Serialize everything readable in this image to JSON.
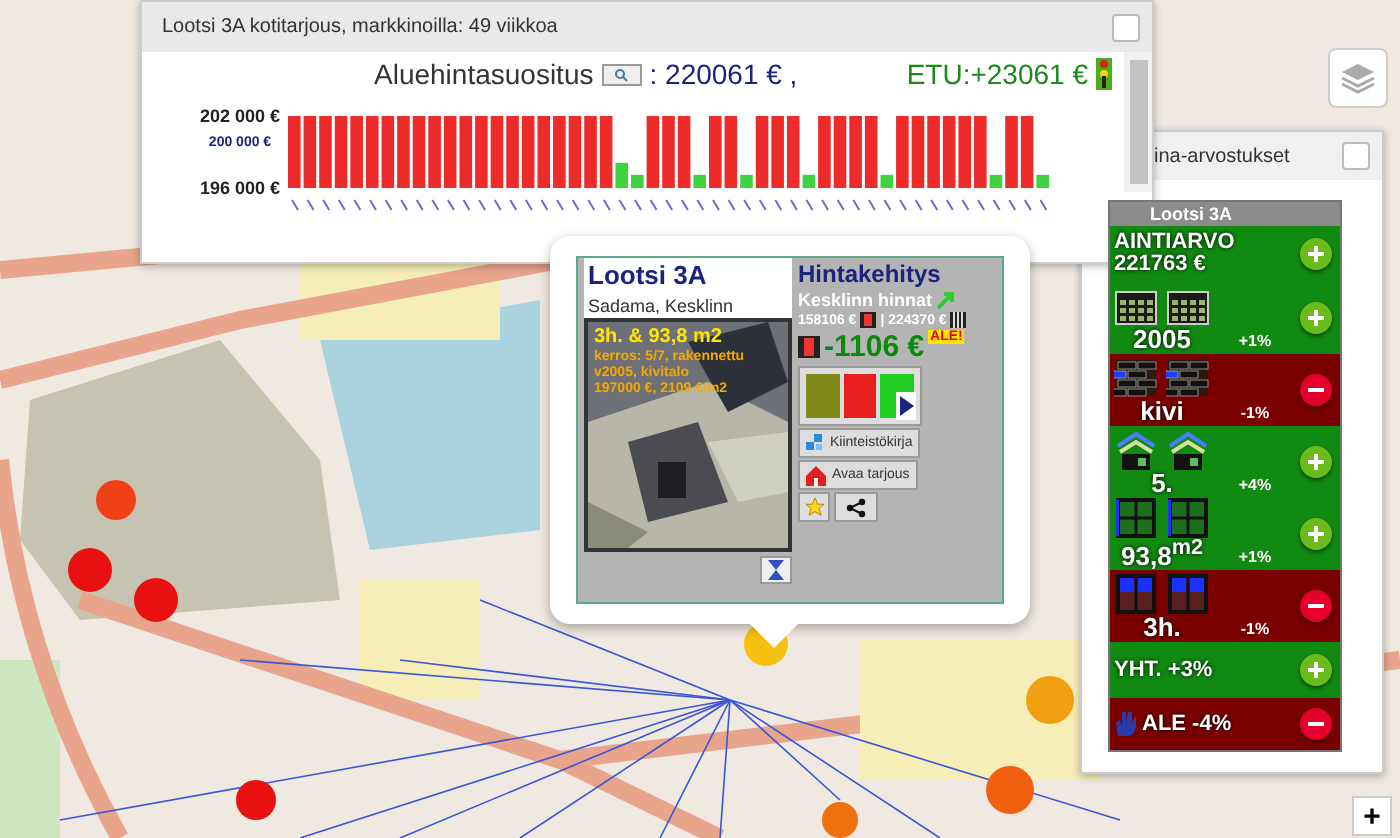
{
  "chart_window": {
    "title": "Lootsi 3A kotitarjous, markkinoilla: 49 viikkoa",
    "checked": false,
    "recommendation_label": "Aluehintasuositus",
    "recommendation_value": ": 220061 € ,",
    "advantage": "ETU:+23061 €",
    "chart_data": {
      "type": "bar",
      "categories": [
        null,
        null,
        null,
        null,
        null,
        null,
        null,
        null,
        null,
        null,
        null,
        null,
        null,
        null,
        null,
        null,
        null,
        null,
        null,
        null,
        null,
        null,
        null,
        null,
        null,
        null,
        null,
        null,
        null,
        null,
        null,
        null,
        null,
        null,
        null,
        null,
        null,
        null,
        null,
        null,
        null,
        null,
        null,
        null,
        null,
        null,
        null,
        null,
        null
      ],
      "ylim": [
        196000,
        202000
      ],
      "yticks": [
        {
          "value": 196000,
          "label": "196 000 €"
        },
        {
          "value": 200000,
          "label": "200 000 €"
        },
        {
          "value": 202000,
          "label": "202 000 €"
        }
      ],
      "stacked": true,
      "series": [
        {
          "color": "#ee2b2b",
          "values": [
            202000,
            202000,
            202000,
            202000,
            202000,
            202000,
            202000,
            202000,
            202000,
            202000,
            202000,
            202000,
            202000,
            202000,
            202000,
            202000,
            202000,
            202000,
            202000,
            202000,
            202000,
            null,
            null,
            202000,
            202000,
            202000,
            null,
            202000,
            202000,
            null,
            202000,
            202000,
            202000,
            null,
            202000,
            202000,
            202000,
            202000,
            null,
            202000,
            202000,
            202000,
            202000,
            202000,
            202000,
            null,
            202000,
            202000,
            null
          ]
        },
        {
          "color": "#3fd43f",
          "values": [
            null,
            null,
            null,
            null,
            null,
            null,
            null,
            null,
            null,
            null,
            null,
            null,
            null,
            null,
            null,
            null,
            null,
            null,
            null,
            null,
            null,
            198100,
            197100,
            null,
            null,
            null,
            197100,
            null,
            null,
            197100,
            null,
            null,
            null,
            197100,
            null,
            null,
            null,
            null,
            197100,
            null,
            null,
            null,
            null,
            null,
            null,
            197100,
            null,
            null,
            197100
          ]
        }
      ]
    }
  },
  "info_popup": {
    "title": "Lootsi 3A",
    "location": "Sadama, Kesklinn",
    "photo_lines": [
      "3h. & 93,8 m2",
      "kerros: 5/7, rakennettu v2005, kivitalo",
      "197000 €, 2109 €/m2"
    ],
    "price_title": "Hintakehitys",
    "area_prices": "Kesklinn hinnat",
    "price_low": "158106 €",
    "price_high": "| 224370 €",
    "difference": "-1106 €",
    "sale_badge": "ALE!",
    "buttons": [
      "Kiinteistökirja",
      "Avaa tarjous"
    ]
  },
  "valuation_window": {
    "title": "ina-arvostukset",
    "checked": false,
    "header": "Lootsi 3A",
    "value_row": {
      "label": "AINTIARVO",
      "value": "221763 €",
      "kind": "plus"
    },
    "factors": [
      {
        "label": "2005",
        "change": "+1%",
        "kind": "plus"
      },
      {
        "label": "kivi",
        "change": "-1%",
        "kind": "minus"
      },
      {
        "label": "5.",
        "change": "+4%",
        "kind": "plus"
      },
      {
        "label": "93,8$^{m2}$",
        "change": "+1%",
        "kind": "plus"
      },
      {
        "label": "3h.",
        "change": "-1%",
        "kind": "minus"
      }
    ],
    "total": {
      "text": "YHT. +3%",
      "kind": "plus"
    },
    "discount": {
      "text": "ALE -4%",
      "kind": "minus"
    }
  },
  "zoom_button": "+"
}
